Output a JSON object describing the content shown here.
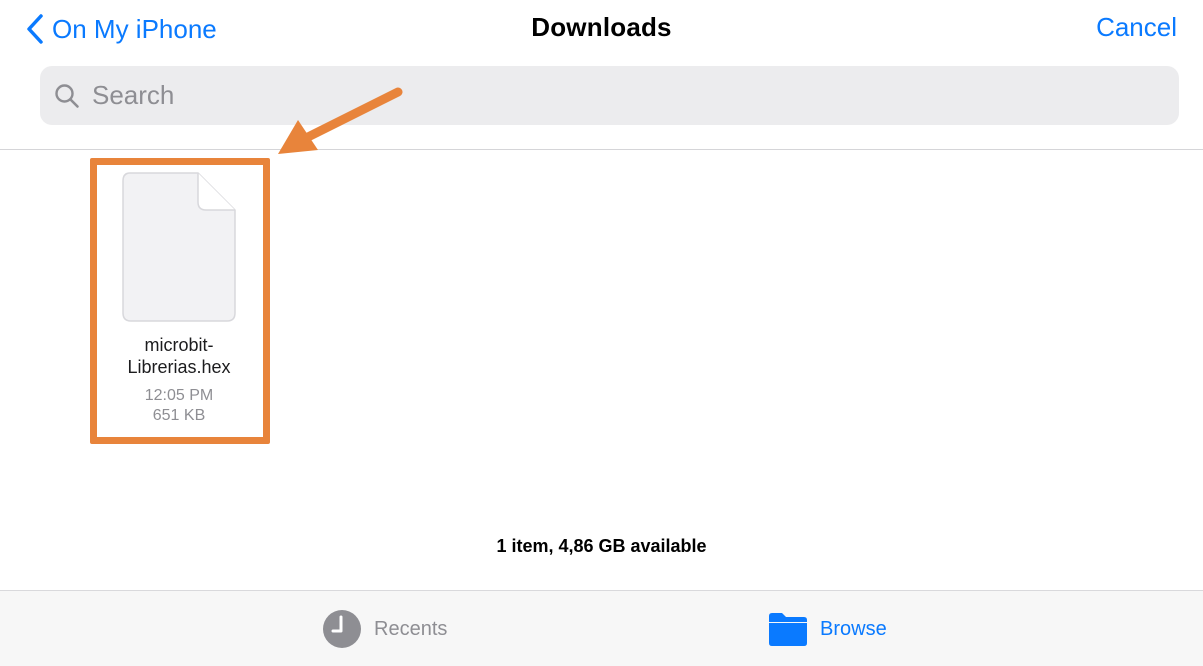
{
  "navbar": {
    "back_label": "On My iPhone",
    "title": "Downloads",
    "cancel_label": "Cancel"
  },
  "search": {
    "placeholder": "Search"
  },
  "files": [
    {
      "name_line1": "microbit-",
      "name_line2": "Librerias.hex",
      "time": "12:05 PM",
      "size": "651 KB"
    }
  ],
  "footer": {
    "status": "1 item, 4,86 GB available"
  },
  "tabs": [
    {
      "label": "Recents",
      "icon": "clock-icon",
      "selected": false
    },
    {
      "label": "Browse",
      "icon": "folder-icon",
      "selected": true
    }
  ],
  "colors": {
    "accent": "#0a7aff",
    "highlight": "#e8843b",
    "secondary_text": "#8e8e93"
  }
}
